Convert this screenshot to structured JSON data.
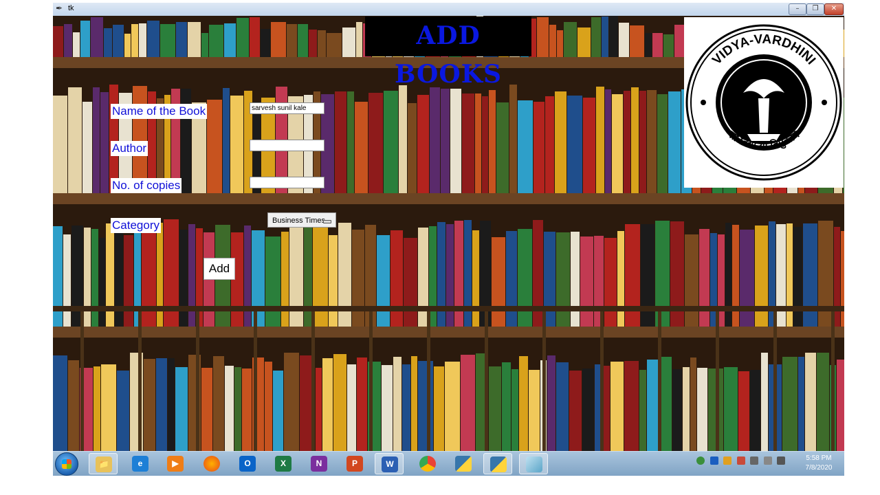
{
  "window": {
    "title": "tk",
    "icon": "feather-icon",
    "controls": [
      "minimize-icon",
      "maximize-icon",
      "close-icon"
    ]
  },
  "heading": "ADD BOOKS",
  "logo": {
    "top_text": "VIDYA-VARDHINI",
    "bottom_text": "सा विद्या या विमुक्तये"
  },
  "form": {
    "name_label": "Name of the Book",
    "name_value": "sarvesh sunil kale",
    "author_label": "Author",
    "author_value": "",
    "copies_label": "No. of copies",
    "copies_value": "",
    "category_label": "Category",
    "category_selected": "Business Times",
    "add_label": "Add"
  },
  "colors": {
    "heading": "#0a18e0",
    "label_text": "#1010d8",
    "shelf": "#5a3a1e"
  },
  "taskbar": {
    "apps": [
      "start-orb-icon",
      "file-explorer-icon",
      "internet-explorer-icon",
      "media-player-icon",
      "firefox-icon",
      "outlook-icon",
      "excel-icon",
      "onenote-icon",
      "powerpoint-icon",
      "word-icon",
      "chrome-icon",
      "python-icon",
      "python-idle-icon",
      "tk-window-icon"
    ],
    "tray_icons": [
      "network-globe-icon",
      "bluetooth-icon",
      "notification-icon",
      "flag-icon",
      "battery-icon",
      "signal-icon",
      "volume-icon"
    ],
    "time": "5:58 PM",
    "date": "7/8/2020"
  }
}
